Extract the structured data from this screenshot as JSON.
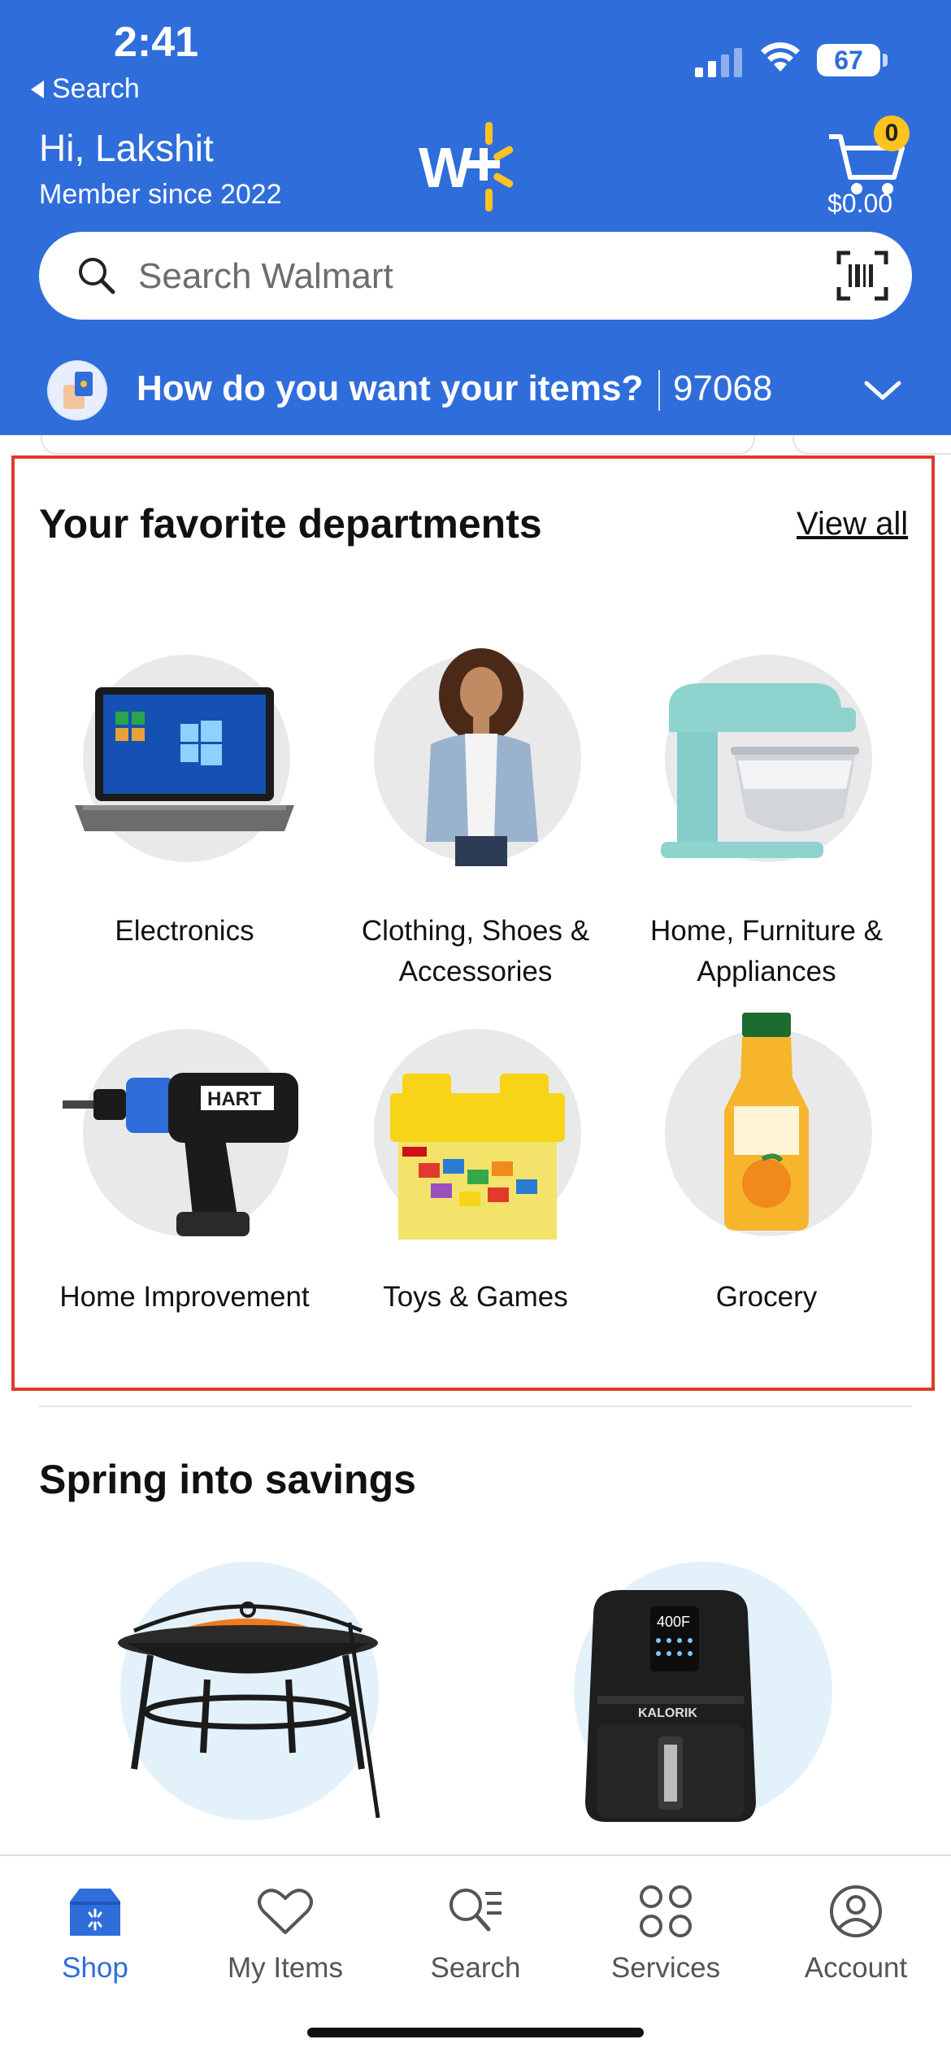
{
  "status_bar": {
    "time": "2:41",
    "back_label": "Search",
    "battery": "67"
  },
  "header": {
    "greeting": "Hi, Lakshit",
    "member_since": "Member since 2022",
    "cart_count": "0",
    "cart_total": "$0.00",
    "brand_color": "#2f6ddb",
    "spark_color": "#ffc220"
  },
  "search": {
    "placeholder": "Search Walmart"
  },
  "delivery": {
    "question": "How do you want your items?",
    "zip": "97068"
  },
  "favorites": {
    "title": "Your favorite departments",
    "view_all": "View all",
    "departments": [
      {
        "label": "Electronics",
        "icon": "laptop"
      },
      {
        "label": "Clothing, Shoes & Accessories",
        "icon": "denim-jacket-model"
      },
      {
        "label": "Home, Furniture & Appliances",
        "icon": "stand-mixer"
      },
      {
        "label": "Home Improvement",
        "icon": "power-drill"
      },
      {
        "label": "Toys & Games",
        "icon": "lego-bucket"
      },
      {
        "label": "Grocery",
        "icon": "orange-juice"
      }
    ]
  },
  "spring": {
    "title": "Spring into savings",
    "items": [
      {
        "icon": "fire-pit"
      },
      {
        "icon": "air-fryer",
        "display_text": "400F",
        "brand": "KALORIK"
      }
    ]
  },
  "tabs": [
    {
      "label": "Shop",
      "icon": "shop-icon",
      "active": true
    },
    {
      "label": "My Items",
      "icon": "heart-icon"
    },
    {
      "label": "Search",
      "icon": "search-list-icon"
    },
    {
      "label": "Services",
      "icon": "services-icon"
    },
    {
      "label": "Account",
      "icon": "account-icon"
    }
  ]
}
